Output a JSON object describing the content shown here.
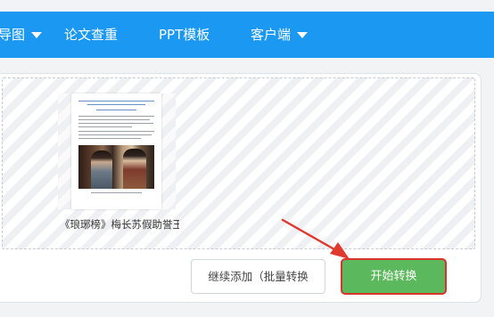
{
  "nav": {
    "items": [
      {
        "label": "导图",
        "has_dropdown": true
      },
      {
        "label": "论文查重",
        "has_dropdown": false
      },
      {
        "label": "PPT模板",
        "has_dropdown": false
      },
      {
        "label": "客户端",
        "has_dropdown": true
      }
    ]
  },
  "file": {
    "name": "《琅琊榜》梅长苏假助誉王..."
  },
  "actions": {
    "continue_label": "继续添加（批量转换",
    "start_label": "开始转换"
  },
  "colors": {
    "topbar": "#1a98f2",
    "start_button": "#5cb85c",
    "highlight": "#d8342c"
  }
}
